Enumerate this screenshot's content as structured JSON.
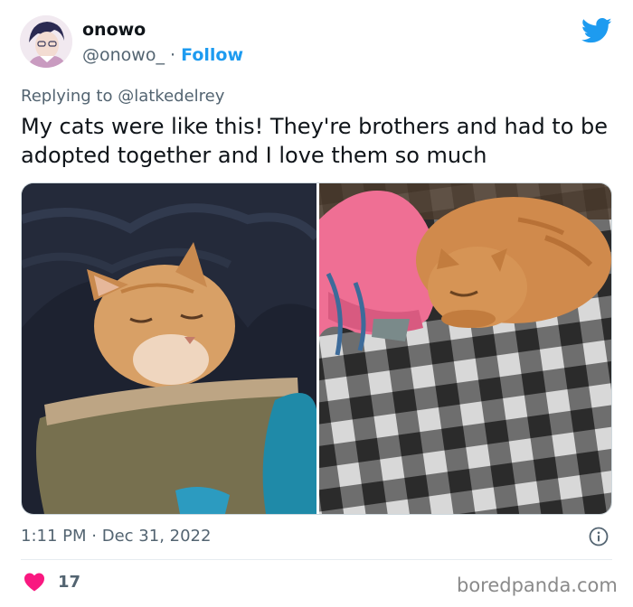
{
  "author": {
    "name": "onowo",
    "handle": "@onowo_",
    "separator": "·",
    "follow_label": "Follow"
  },
  "reply": {
    "prefix": "Replying to",
    "mention": "@latkedelrey"
  },
  "tweet": {
    "text": "My cats were like this! They're brothers and had to be adopted together and I love them so much",
    "time": "1:11 PM",
    "separator": "·",
    "date": "Dec 31, 2022"
  },
  "stats": {
    "likes": "17"
  },
  "watermark": "boredpanda.com",
  "icons": {
    "brand": "twitter-bird-icon",
    "info": "info-icon",
    "like": "heart-icon"
  },
  "colors": {
    "accent": "#1d9bf0",
    "like": "#f91880",
    "muted": "#536471",
    "text": "#0f1419"
  }
}
